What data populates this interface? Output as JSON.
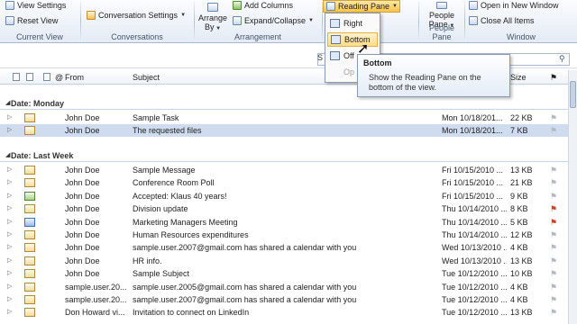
{
  "ribbon": {
    "current_view": {
      "view_settings": "View Settings",
      "reset_view": "Reset View",
      "label": "Current View"
    },
    "conversations": {
      "conversation_settings": "Conversation Settings",
      "label": "Conversations"
    },
    "arrangement": {
      "arrange_by_line1": "Arrange",
      "arrange_by_line2": "By",
      "add_columns": "Add Columns",
      "expand_collapse": "Expand/Collapse",
      "label": "Arrangement"
    },
    "layout": {
      "reading_pane": "Reading Pane"
    },
    "people_pane": {
      "line1": "People",
      "line2": "Pane",
      "label": "People Pane"
    },
    "window": {
      "open_new_window": "Open in New Window",
      "close_all_items": "Close All Items",
      "label": "Window"
    }
  },
  "reading_pane_menu": {
    "items": [
      {
        "label": "Right",
        "selected": false,
        "disabled": false
      },
      {
        "label": "Bottom",
        "selected": true,
        "disabled": false
      },
      {
        "label": "Off",
        "selected": false,
        "disabled": false
      },
      {
        "label": "Op",
        "selected": false,
        "disabled": true
      }
    ]
  },
  "tooltip": {
    "title": "Bottom",
    "description_line1": "Show the Reading Pane on the",
    "description_line2": "bottom of the view."
  },
  "search": {
    "left_char": "S"
  },
  "columns": {
    "from": "From",
    "subject": "Subject",
    "size": "Size"
  },
  "groups": [
    {
      "title": "Date: Monday",
      "rows": [
        {
          "from": "John Doe",
          "subject": "Sample Task",
          "received": "Mon 10/18/201...",
          "size": "22 KB",
          "icon": "task",
          "selected": false,
          "flag": "none"
        },
        {
          "from": "John Doe",
          "subject": "The requested files",
          "received": "Mon 10/18/201...",
          "size": "7 KB",
          "icon": "mail",
          "selected": true,
          "flag": "none"
        }
      ]
    },
    {
      "title": "Date: Last Week",
      "rows": [
        {
          "from": "John Doe",
          "subject": "Sample Message",
          "received": "Fri 10/15/2010 ...",
          "size": "13 KB",
          "icon": "mail",
          "flag": "none"
        },
        {
          "from": "John Doe",
          "subject": "Conference Room Poll",
          "received": "Fri 10/15/2010 ...",
          "size": "21 KB",
          "icon": "mail",
          "flag": "none"
        },
        {
          "from": "John Doe",
          "subject": "Accepted: Klaus 40 years!",
          "received": "Fri 10/15/2010 ...",
          "size": "9 KB",
          "icon": "accept",
          "flag": "none"
        },
        {
          "from": "John Doe",
          "subject": "Division update",
          "received": "Thu 10/14/2010 ...",
          "size": "8 KB",
          "icon": "mail",
          "flag": "red"
        },
        {
          "from": "John Doe",
          "subject": "Marketing Managers Meeting",
          "received": "Thu 10/14/2010 ...",
          "size": "5 KB",
          "icon": "calendar",
          "flag": "red"
        },
        {
          "from": "John Doe",
          "subject": "Human Resources expenditures",
          "received": "Thu 10/14/2010 ...",
          "size": "12 KB",
          "icon": "mail",
          "flag": "none"
        },
        {
          "from": "John Doe",
          "subject": "sample.user.2007@gmail.com has shared a calendar with you",
          "received": "Wed 10/13/2010 ...",
          "size": "4 KB",
          "icon": "mail",
          "flag": "none"
        },
        {
          "from": "John Doe",
          "subject": "HR info.",
          "received": "Wed 10/13/2010 ...",
          "size": "13 KB",
          "icon": "mail",
          "flag": "none"
        },
        {
          "from": "John Doe",
          "subject": "Sample Subject",
          "received": "Tue 10/12/2010 ...",
          "size": "10 KB",
          "icon": "mail",
          "flag": "none"
        },
        {
          "from": "sample.user.20...",
          "subject": "sample.user.2005@gmail.com has shared a calendar with you",
          "received": "Tue 10/12/2010 ...",
          "size": "4 KB",
          "icon": "mail",
          "flag": "none"
        },
        {
          "from": "sample.user.20...",
          "subject": "sample.user.2007@gmail.com has shared a calendar with you",
          "received": "Tue 10/12/2010 ...",
          "size": "4 KB",
          "icon": "mail",
          "flag": "none"
        },
        {
          "from": "Don Howard vi...",
          "subject": "Invitation to connect on LinkedIn",
          "received": "Tue 10/12/2010 ...",
          "size": "13 KB",
          "icon": "mail",
          "flag": "none"
        }
      ]
    }
  ]
}
